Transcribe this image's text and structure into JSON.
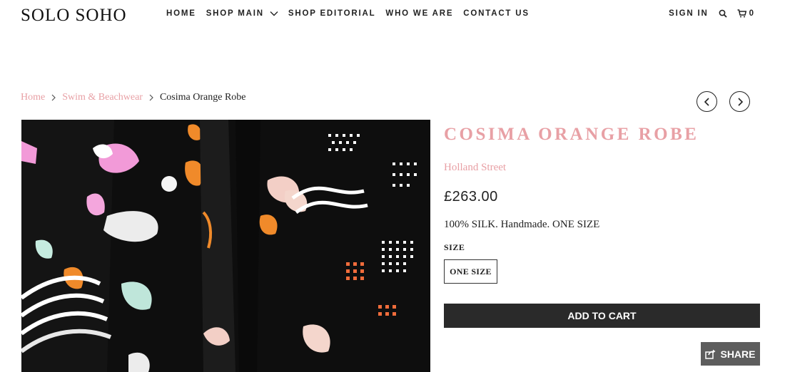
{
  "header": {
    "logo": "SOLO SOHO",
    "nav": [
      {
        "label": "HOME"
      },
      {
        "label": "SHOP MAIN"
      },
      {
        "label": "SHOP EDITORIAL"
      },
      {
        "label": "WHO WE ARE"
      },
      {
        "label": "CONTACT US"
      }
    ],
    "sign_in": "SIGN IN",
    "cart_count": "0"
  },
  "breadcrumb": {
    "home": "Home",
    "category": "Swim & Beachwear",
    "current": "Cosima Orange Robe"
  },
  "product": {
    "title": "COSIMA ORANGE ROBE",
    "vendor": "Holland Street",
    "price": "£263.00",
    "description": "100% SILK. Handmade. ONE SIZE",
    "size_label": "SIZE",
    "size_option": "ONE SIZE",
    "add_to_cart": "ADD TO CART",
    "share": "SHARE"
  },
  "colors": {
    "accent_pink": "#e8a0a5",
    "dark_button": "#2a2a2a",
    "share_bg": "#5d5d5d"
  }
}
